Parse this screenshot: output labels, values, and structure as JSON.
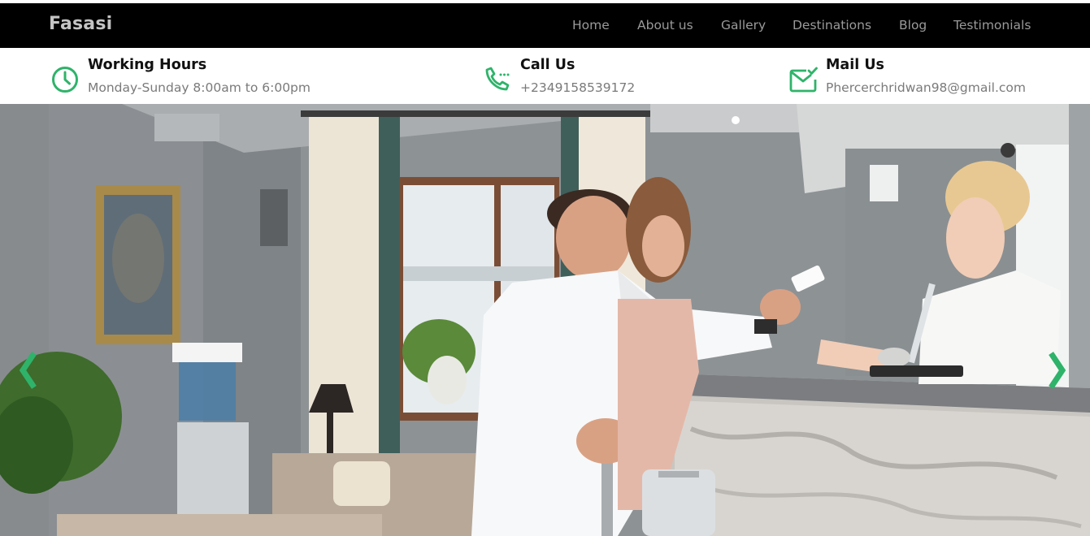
{
  "brand": "Fasasi",
  "nav": {
    "items": [
      "Home",
      "About us",
      "Gallery",
      "Destinations",
      "Blog",
      "Testimonials"
    ]
  },
  "info": {
    "hours": {
      "title": "Working Hours",
      "text": "Monday-Sunday 8:00am to 6:00pm",
      "icon": "clock-icon"
    },
    "call": {
      "title": "Call Us",
      "text": "+2349158539172",
      "icon": "phone-icon"
    },
    "mail": {
      "title": "Mail Us",
      "text": "Phercerchridwan98@gmail.com",
      "icon": "mail-check-icon"
    }
  },
  "hero": {
    "image": "hotel-reception-photo",
    "prev_icon": "chevron-left-icon",
    "next_icon": "chevron-right-icon"
  },
  "colors": {
    "accent": "#2fb36a",
    "navbar_bg": "#000000",
    "brand_text": "#c4c4c4",
    "nav_text": "#9a9a9a"
  }
}
